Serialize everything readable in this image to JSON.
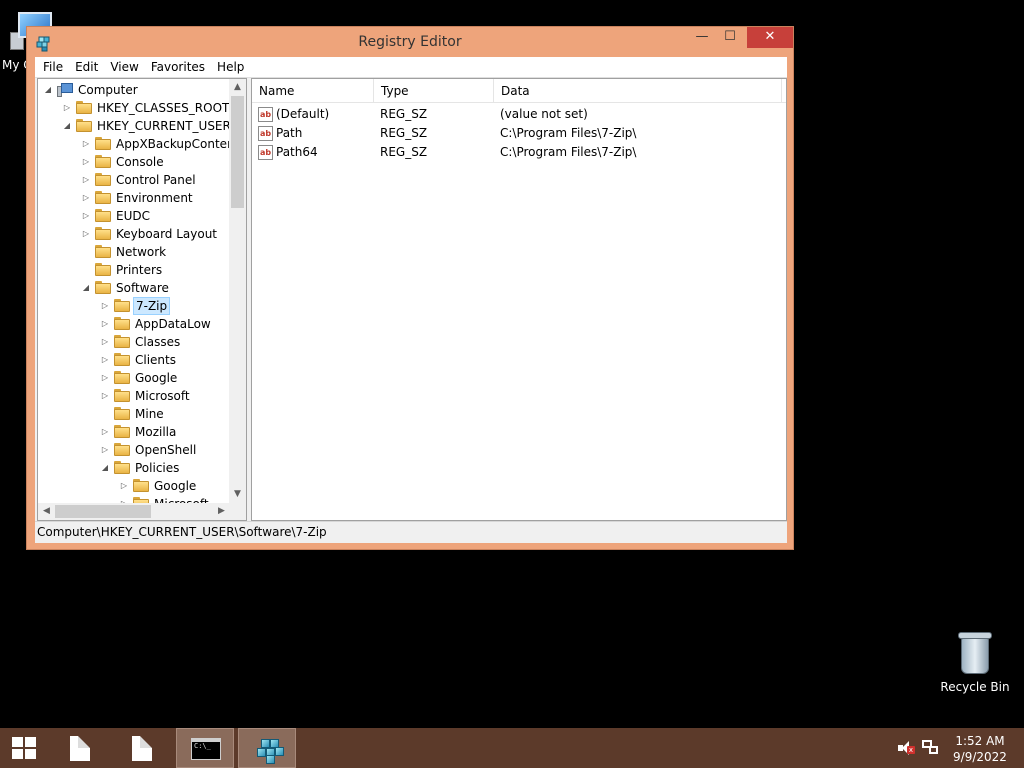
{
  "desktop": {
    "my_computer_label": "My C",
    "recycle_bin_label": "Recycle Bin"
  },
  "window": {
    "title": "Registry Editor",
    "caption": {
      "minimize": "—",
      "maximize": "☐",
      "close": "✕"
    }
  },
  "menu": [
    "File",
    "Edit",
    "View",
    "Favorites",
    "Help"
  ],
  "tree": {
    "items": [
      {
        "label": "Computer",
        "level": 0,
        "expander": "expanded",
        "icon": "computer-icon",
        "selected": false
      },
      {
        "label": "HKEY_CLASSES_ROOT",
        "level": 1,
        "expander": "collapsed",
        "icon": "folder-icon",
        "selected": false
      },
      {
        "label": "HKEY_CURRENT_USER",
        "level": 1,
        "expander": "expanded",
        "icon": "folder-icon",
        "selected": false
      },
      {
        "label": "AppXBackupContent",
        "level": 2,
        "expander": "collapsed",
        "icon": "folder-icon",
        "selected": false
      },
      {
        "label": "Console",
        "level": 2,
        "expander": "collapsed",
        "icon": "folder-icon",
        "selected": false
      },
      {
        "label": "Control Panel",
        "level": 2,
        "expander": "collapsed",
        "icon": "folder-icon",
        "selected": false
      },
      {
        "label": "Environment",
        "level": 2,
        "expander": "collapsed",
        "icon": "folder-icon",
        "selected": false
      },
      {
        "label": "EUDC",
        "level": 2,
        "expander": "collapsed",
        "icon": "folder-icon",
        "selected": false
      },
      {
        "label": "Keyboard Layout",
        "level": 2,
        "expander": "collapsed",
        "icon": "folder-icon",
        "selected": false
      },
      {
        "label": "Network",
        "level": 2,
        "expander": "none",
        "icon": "folder-icon",
        "selected": false
      },
      {
        "label": "Printers",
        "level": 2,
        "expander": "none",
        "icon": "folder-icon",
        "selected": false
      },
      {
        "label": "Software",
        "level": 2,
        "expander": "expanded",
        "icon": "folder-icon",
        "selected": false
      },
      {
        "label": "7-Zip",
        "level": 3,
        "expander": "collapsed",
        "icon": "folder-icon",
        "selected": true
      },
      {
        "label": "AppDataLow",
        "level": 3,
        "expander": "collapsed",
        "icon": "folder-icon",
        "selected": false
      },
      {
        "label": "Classes",
        "level": 3,
        "expander": "collapsed",
        "icon": "folder-icon",
        "selected": false
      },
      {
        "label": "Clients",
        "level": 3,
        "expander": "collapsed",
        "icon": "folder-icon",
        "selected": false
      },
      {
        "label": "Google",
        "level": 3,
        "expander": "collapsed",
        "icon": "folder-icon",
        "selected": false
      },
      {
        "label": "Microsoft",
        "level": 3,
        "expander": "collapsed",
        "icon": "folder-icon",
        "selected": false
      },
      {
        "label": "Mine",
        "level": 3,
        "expander": "none",
        "icon": "folder-icon",
        "selected": false
      },
      {
        "label": "Mozilla",
        "level": 3,
        "expander": "collapsed",
        "icon": "folder-icon",
        "selected": false
      },
      {
        "label": "OpenShell",
        "level": 3,
        "expander": "collapsed",
        "icon": "folder-icon",
        "selected": false
      },
      {
        "label": "Policies",
        "level": 3,
        "expander": "expanded",
        "icon": "folder-icon",
        "selected": false
      },
      {
        "label": "Google",
        "level": 4,
        "expander": "collapsed",
        "icon": "folder-icon",
        "selected": false
      },
      {
        "label": "Microsoft",
        "level": 4,
        "expander": "collapsed",
        "icon": "folder-icon",
        "selected": false
      }
    ]
  },
  "list": {
    "columns": [
      "Name",
      "Type",
      "Data"
    ],
    "rows": [
      {
        "name": "(Default)",
        "type": "REG_SZ",
        "data": "(value not set)",
        "icon": "string-value-icon"
      },
      {
        "name": "Path",
        "type": "REG_SZ",
        "data": "C:\\Program Files\\7-Zip\\",
        "icon": "string-value-icon"
      },
      {
        "name": "Path64",
        "type": "REG_SZ",
        "data": "C:\\Program Files\\7-Zip\\",
        "icon": "string-value-icon"
      }
    ]
  },
  "statusbar": {
    "path": "Computer\\HKEY_CURRENT_USER\\Software\\7-Zip"
  },
  "taskbar": {
    "time": "1:52 AM",
    "date": "9/9/2022",
    "cmd_glyph": "C:\\_"
  },
  "colors": {
    "window_frame": "#eea47b",
    "close_button": "#c7403a",
    "taskbar": "#5c3a2a",
    "selection": "#cce8ff"
  }
}
